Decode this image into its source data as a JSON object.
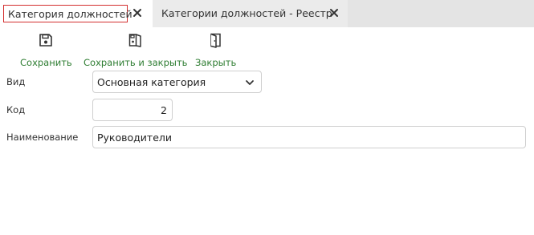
{
  "tabs": [
    {
      "label": "Категория должностей",
      "active": true
    },
    {
      "label": "Категории должностей - Реестр",
      "active": false
    }
  ],
  "toolbar": {
    "save_label": "Сохранить",
    "save_close_label": "Сохранить и закрыть",
    "close_label": "Закрыть"
  },
  "form": {
    "kind_label": "Вид",
    "kind_value": "Основная категория",
    "code_label": "Код",
    "code_value": "2",
    "name_label": "Наименование",
    "name_value": "Руководители"
  },
  "colors": {
    "accent_green": "#2e7d32",
    "active_tab_border": "#d32f2f",
    "tabbar_bg": "#e4e4e4"
  }
}
